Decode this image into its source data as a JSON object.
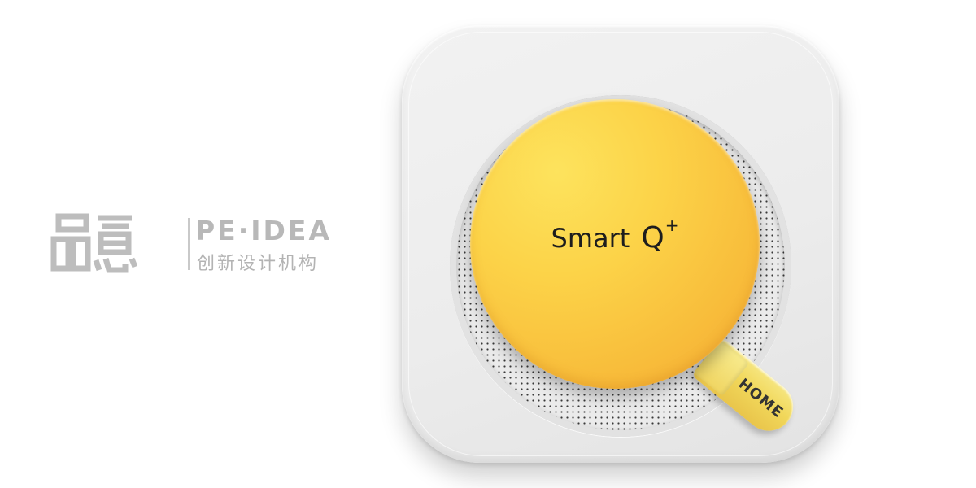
{
  "logo": {
    "mark_text": "品意",
    "english": "PE·IDEA",
    "chinese": "创新设计机构",
    "color": "#b8b8b8"
  },
  "device": {
    "brand_word": "Smart",
    "brand_letter": "Q",
    "brand_sup": "+",
    "home_label": "HOME",
    "colors": {
      "body": "#eeeeee",
      "dial": "#fbcb43",
      "handle": "#f1d75a",
      "grille_dots": "#3a3a3a"
    }
  }
}
